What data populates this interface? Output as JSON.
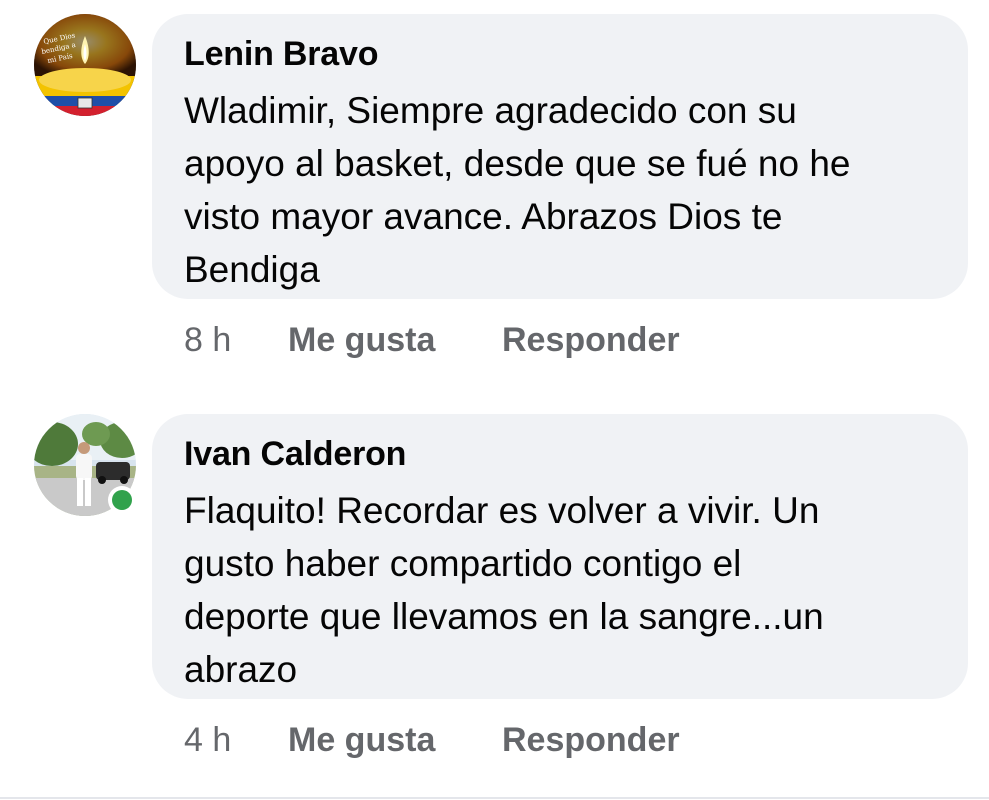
{
  "comments": [
    {
      "author": "Lenin Bravo",
      "text": "Wladimir,  Siempre agradecido con su\napoyo al basket,  desde que se fué no he\nvisto mayor avance. Abrazos Dios te\nBendiga",
      "time": "8 h",
      "like_label": "Me gusta",
      "reply_label": "Responder",
      "avatar_icon": "candle-flag-avatar",
      "avatar_text": "Que Dios bendiga a mi País"
    },
    {
      "author": "Ivan Calderon",
      "text": "Flaquito! Recordar es volver a vivir. Un\ngusto haber compartido contigo el\ndeporte que llevamos en la sangre...un\nabrazo",
      "time": "4 h",
      "like_label": "Me gusta",
      "reply_label": "Responder",
      "avatar_icon": "person-outdoors-avatar",
      "online": true
    }
  ],
  "colors": {
    "bubble_bg": "#f0f2f5",
    "meta_text": "#65676b",
    "online_green": "#31a24c"
  }
}
